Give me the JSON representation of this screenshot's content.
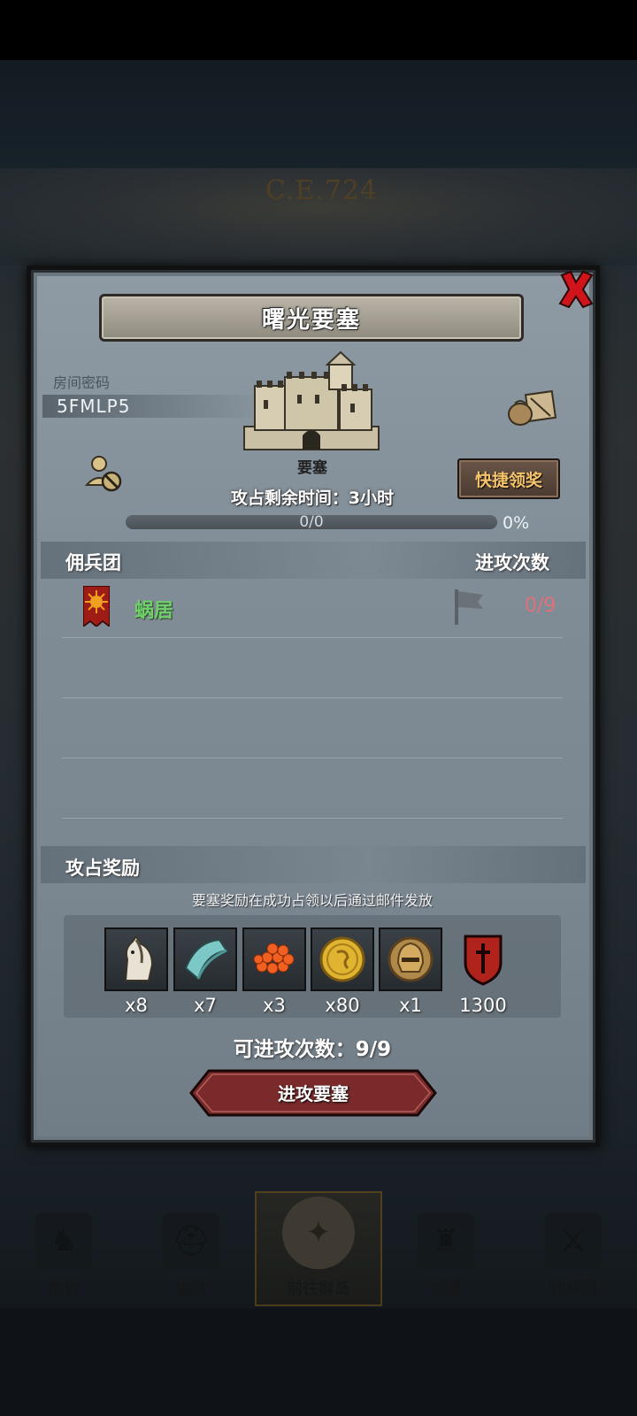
{
  "backdrop": {
    "era_label": "C.E.724"
  },
  "dialog": {
    "title": "曙光要塞",
    "room": {
      "label": "房间密码",
      "code": "5FMLP5"
    },
    "fortress_label": "要塞",
    "timer": "攻占剩余时间：3小时",
    "quick_claim": "快捷领奖",
    "progress": {
      "text": "0/0",
      "percent_text": "0%",
      "fraction": 0
    },
    "guild_section": {
      "left": "佣兵团",
      "right": "进攻次数"
    },
    "guild_rows": [
      {
        "name": "蜗居",
        "attacks": "0/9",
        "name_color": "#6ed16a",
        "attacks_color": "#e2707a"
      }
    ],
    "reward_section": {
      "title": "攻占奖励",
      "note": "要塞奖励在成功占领以后通过邮件发放"
    },
    "rewards": [
      {
        "icon": "horse-icon",
        "qty": "x8"
      },
      {
        "icon": "cloth-icon",
        "qty": "x7"
      },
      {
        "icon": "roe-icon",
        "qty": "x3"
      },
      {
        "icon": "gold-coin-icon",
        "qty": "x80"
      },
      {
        "icon": "helmet-icon",
        "qty": "x1"
      },
      {
        "icon": "guild-badge-icon",
        "qty": "1300"
      }
    ],
    "attacks_available": "可进攻次数：9/9",
    "attack_button": "进攻要塞"
  },
  "bottom_nav": [
    {
      "label": "角色",
      "icon": "knight-icon",
      "active": false
    },
    {
      "label": "编队",
      "icon": "helmet-team-icon",
      "active": false
    },
    {
      "label": "前往群岛",
      "icon": "compass-icon",
      "active": true
    },
    {
      "label": "城堡",
      "icon": "castle-icon",
      "active": false
    },
    {
      "label": "佣兵团",
      "icon": "mercenary-icon",
      "active": false
    }
  ],
  "colors": {
    "accent_gold": "#f6c46a",
    "attack_red": "#7a2a2a"
  }
}
